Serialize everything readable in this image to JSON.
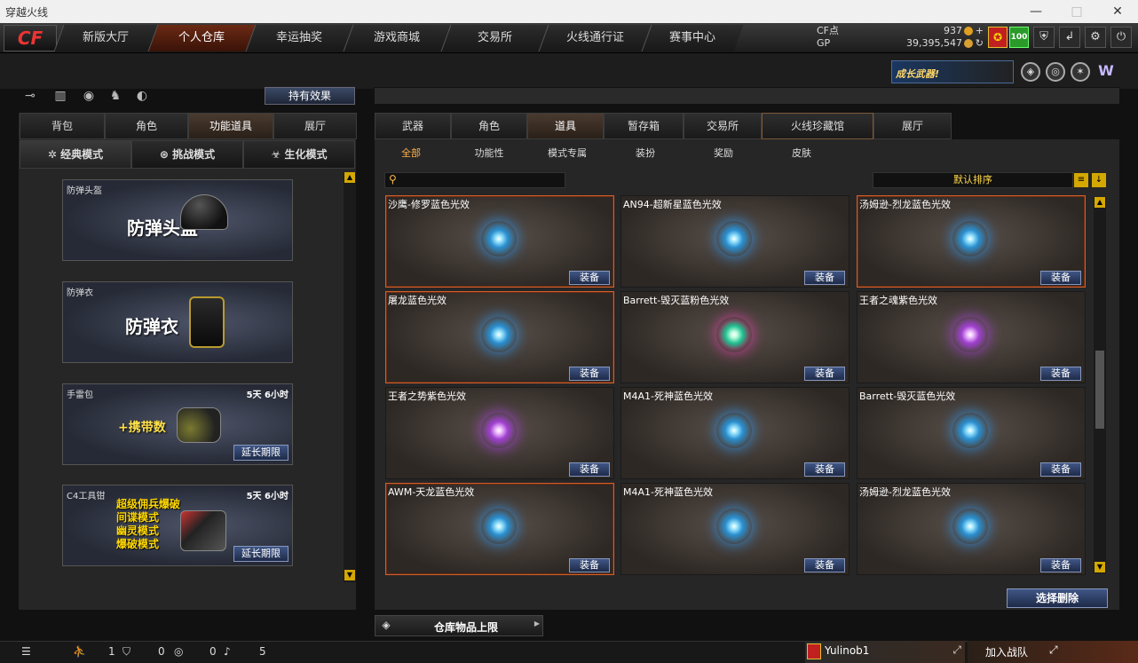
{
  "window": {
    "title": "穿越火线",
    "minimize": "—",
    "maximize": "□",
    "close": "✕"
  },
  "logo": "CF",
  "nav": [
    {
      "label": "新版大厅"
    },
    {
      "label": "个人仓库"
    },
    {
      "label": "幸运抽奖"
    },
    {
      "label": "游戏商城"
    },
    {
      "label": "交易所"
    },
    {
      "label": "火线通行证"
    },
    {
      "label": "赛事中心"
    }
  ],
  "currency": {
    "cf_label": "CF点",
    "cf_value": "937",
    "gp_label": "GP",
    "gp_value": "39,395,547",
    "badge": "100"
  },
  "top_icons": [
    "shield-icon",
    "return-icon",
    "gear-icon",
    "power-icon"
  ],
  "promo": "成长武器!",
  "effect_button": "持有效果",
  "left_tabs": [
    {
      "label": "背包"
    },
    {
      "label": "角色"
    },
    {
      "label": "功能道具"
    },
    {
      "label": "展厅"
    }
  ],
  "mode_tabs": [
    {
      "label": "经典模式"
    },
    {
      "label": "挑战模式"
    },
    {
      "label": "生化模式"
    }
  ],
  "left_items": [
    {
      "title": "防弹头盔",
      "art_text": "防弹头盔",
      "duration": "",
      "button": ""
    },
    {
      "title": "防弹衣",
      "art_text": "防弹衣",
      "duration": "",
      "button": ""
    },
    {
      "title": "手雷包",
      "art_text": "+携带数",
      "duration": "5天 6小时",
      "button": "延长期限"
    },
    {
      "title": "C4工具钳",
      "art_lines": [
        "超级佣兵爆破",
        "间谍模式",
        "幽灵模式",
        "爆破模式"
      ],
      "duration": "5天 6小时",
      "button": "延长期限"
    }
  ],
  "right_tabs": [
    {
      "label": "武器"
    },
    {
      "label": "角色"
    },
    {
      "label": "道具"
    },
    {
      "label": "暂存箱"
    },
    {
      "label": "交易所"
    },
    {
      "label": "火线珍藏馆"
    },
    {
      "label": "展厅"
    }
  ],
  "sub_tabs": [
    {
      "label": "全部"
    },
    {
      "label": "功能性"
    },
    {
      "label": "模式专属"
    },
    {
      "label": "装扮"
    },
    {
      "label": "奖励"
    },
    {
      "label": "皮肤"
    }
  ],
  "search": {
    "placeholder": ""
  },
  "sort": "默认排序",
  "items": [
    {
      "name": "沙鹰-修罗蓝色光效",
      "button": "装备"
    },
    {
      "name": "AN94-超新星蓝色光效",
      "button": "装备"
    },
    {
      "name": "汤姆逊-烈龙蓝色光效",
      "button": "装备"
    },
    {
      "name": "屠龙蓝色光效",
      "button": "装备"
    },
    {
      "name": "Barrett-毁灭蓝粉色光效",
      "button": "装备"
    },
    {
      "name": "王者之魂紫色光效",
      "button": "装备"
    },
    {
      "name": "王者之势紫色光效",
      "button": "装备"
    },
    {
      "name": "M4A1-死神蓝色光效",
      "button": "装备"
    },
    {
      "name": "Barrett-毁灭蓝色光效",
      "button": "装备"
    },
    {
      "name": "AWM-天龙蓝色光效",
      "button": "装备"
    },
    {
      "name": "M4A1-死神蓝色光效",
      "button": "装备"
    },
    {
      "name": "汤姆逊-烈龙蓝色光效",
      "button": "装备"
    }
  ],
  "delete_button": "选择删除",
  "limit_button": "仓库物品上限",
  "bottom": {
    "friends": "1",
    "shield": "0",
    "chat": "0",
    "sound": "5",
    "username": "Yulinob1",
    "join": "加入战队"
  }
}
